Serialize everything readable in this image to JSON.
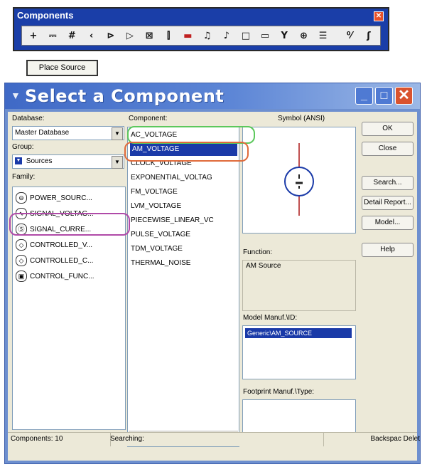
{
  "toolbar": {
    "title": "Components",
    "close_glyph": "✕",
    "tools": [
      {
        "name": "power-source-tool",
        "glyph": "+"
      },
      {
        "name": "resistor-tool",
        "glyph": "⎓"
      },
      {
        "name": "capacitor-tool",
        "glyph": "#"
      },
      {
        "name": "diode-tool",
        "glyph": "‹"
      },
      {
        "name": "transistor-tool",
        "glyph": "⊳"
      },
      {
        "name": "analog-tool",
        "glyph": "▷"
      },
      {
        "name": "ttl-tool",
        "glyph": "⊠"
      },
      {
        "name": "cmos-tool",
        "glyph": "⫿"
      },
      {
        "name": "mcu-tool",
        "glyph": "▬",
        "color": "red"
      },
      {
        "name": "advanced-peripherals-tool",
        "glyph": "♫"
      },
      {
        "name": "misc-digital-tool",
        "glyph": "♪"
      },
      {
        "name": "mixed-tool",
        "glyph": "□"
      },
      {
        "name": "indicator-tool",
        "glyph": "▭"
      },
      {
        "name": "power-component-tool",
        "glyph": "Y"
      },
      {
        "name": "misc-tool",
        "glyph": "⊕"
      },
      {
        "name": "rf-tool",
        "glyph": "☰"
      },
      {
        "name": "electromechanical-tool",
        "glyph": "⁰⁄"
      },
      {
        "name": "ladder-tool",
        "glyph": "ʃ"
      }
    ]
  },
  "place_source_label": "Place Source",
  "dialog": {
    "title": "Select a Component",
    "window_buttons": {
      "min": "_",
      "max": "□",
      "close": "✕"
    },
    "database_label": "Database:",
    "database_value": "Master Database",
    "group_label": "Group:",
    "group_value": "Sources",
    "family_label": "Family:",
    "family_items": [
      {
        "label": "POWER_SOURC...",
        "icon": "⊖"
      },
      {
        "label": "SIGNAL_VOLTAG...",
        "icon": "∿"
      },
      {
        "label": "SIGNAL_CURRE...",
        "icon": "Ⓢ"
      },
      {
        "label": "CONTROLLED_V...",
        "icon": "◇"
      },
      {
        "label": "CONTROLLED_C...",
        "icon": "◇"
      },
      {
        "label": "CONTROL_FUNC...",
        "icon": "▣"
      }
    ],
    "component_label": "Component:",
    "components": [
      "AC_VOLTAGE",
      "AM_VOLTAGE",
      "CLOCK_VOLTAGE",
      "EXPONENTIAL_VOLTAG",
      "FM_VOLTAGE",
      "LVM_VOLTAGE",
      "PIECEWISE_LINEAR_VC",
      "PULSE_VOLTAGE",
      "TDM_VOLTAGE",
      "THERMAL_NOISE"
    ],
    "selected_component": "AM_VOLTAGE",
    "symbol_label": "Symbol (ANSI)",
    "function_label": "Function:",
    "function_value": "AM Source",
    "model_label": "Model Manuf.\\ID:",
    "model_value": "Generic\\AM_SOURCE",
    "footprint_label": "Footprint Manuf.\\Type:",
    "buttons": {
      "ok": "OK",
      "close": "Close",
      "search": "Search...",
      "detail": "Detail Report...",
      "model": "Model...",
      "help": "Help"
    },
    "status": {
      "components": "Components: 10",
      "searching": "Searching:",
      "backspace": "Backspac Delet"
    },
    "scroll_left": "◀",
    "scroll_right": "▶",
    "combo_arrow": "▼"
  },
  "colors": {
    "selection": "#1a3aa8",
    "highlight_green": "#5cc85c",
    "highlight_orange": "#e06a3a",
    "highlight_magenta": "#b04aa8"
  }
}
